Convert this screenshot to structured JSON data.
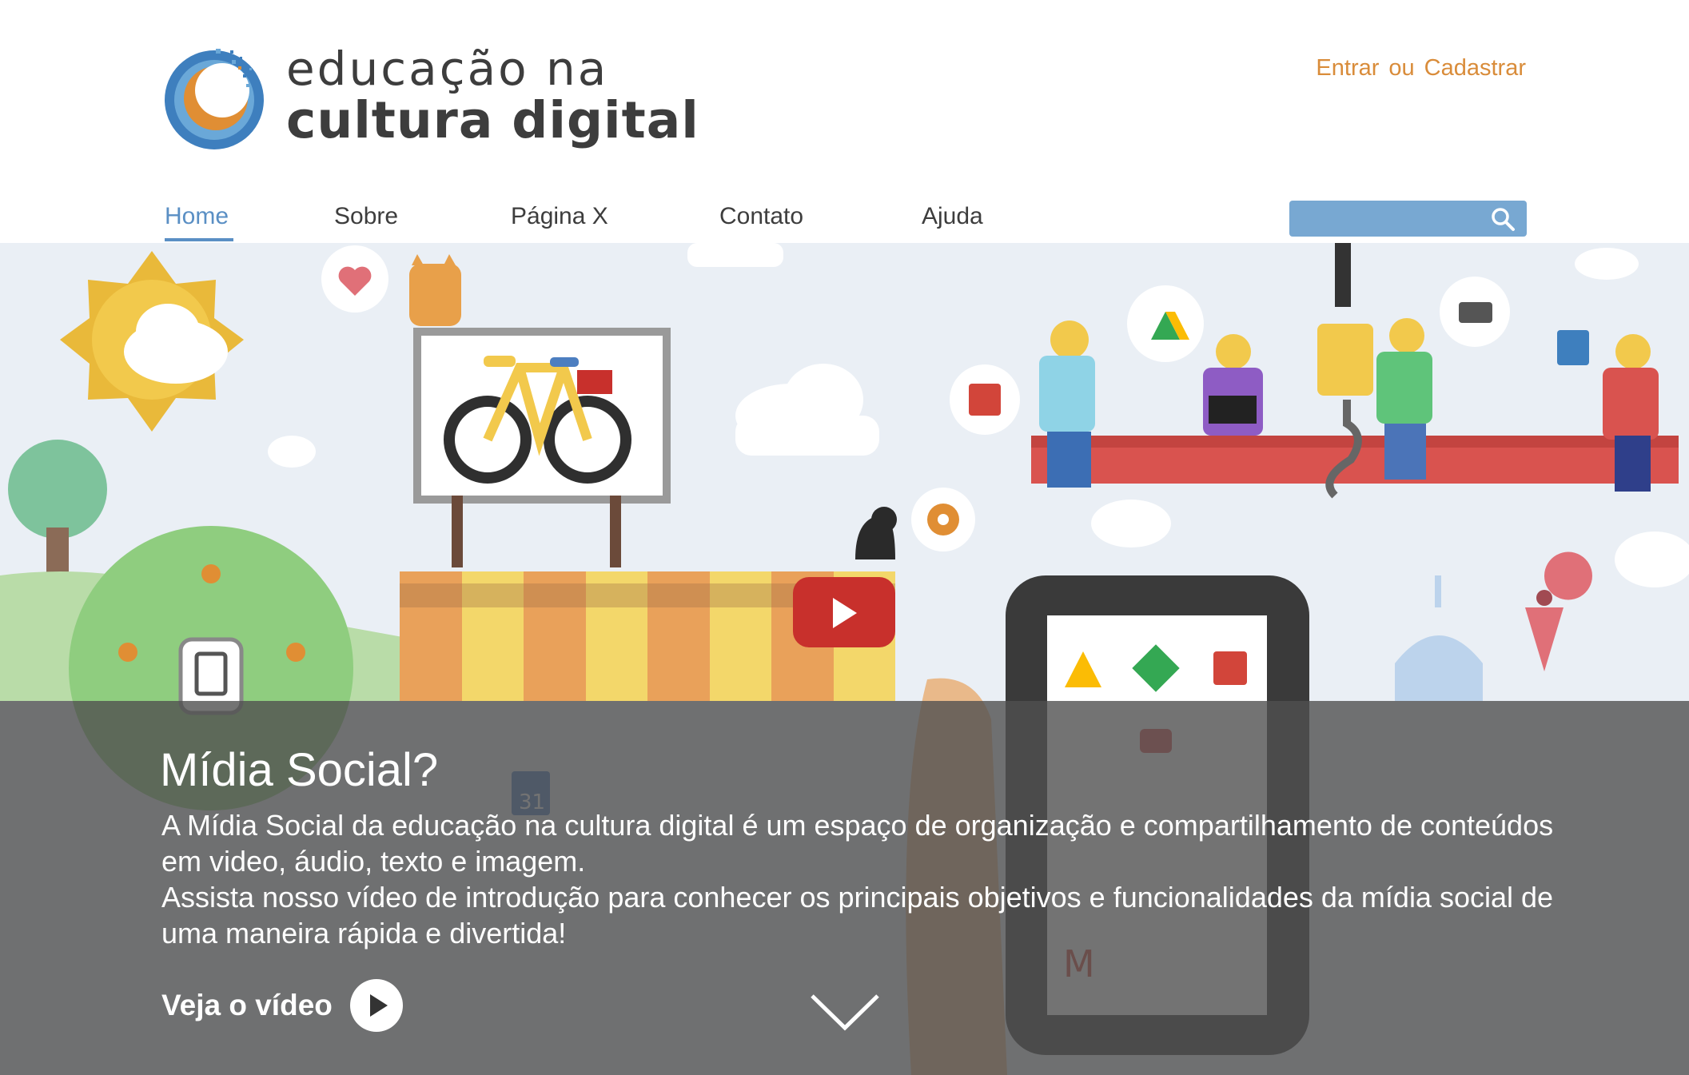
{
  "brand": {
    "line1": "educação na",
    "line2": "cultura digital"
  },
  "auth": {
    "login": "Entrar",
    "separator": "ou",
    "register": "Cadastrar"
  },
  "nav": [
    {
      "label": "Home",
      "active": true
    },
    {
      "label": "Sobre",
      "active": false
    },
    {
      "label": "Página X",
      "active": false
    },
    {
      "label": "Contato",
      "active": false
    },
    {
      "label": "Ajuda",
      "active": false
    }
  ],
  "search": {
    "placeholder": "",
    "icon": "search-icon"
  },
  "hero": {
    "title": "Mídia Social?",
    "paragraph1": "A Mídia Social da educação na cultura digital é um espaço de organização e compartilhamento de conteúdos em video, áudio, texto e imagem.",
    "paragraph2": "Assista nosso vídeo de introdução para conhecer os principais objetivos e funcionalidades da mídia social de uma maneira rápida e divertida!",
    "cta_label": "Veja o vídeo",
    "illustration_labels": {
      "calendar_day": "31"
    }
  },
  "colors": {
    "accent_orange": "#d98c3a",
    "nav_active_blue": "#5a8fc4",
    "search_bg": "#78a8d2",
    "youtube_red": "#c8302c",
    "hero_bg": "#eaeff5"
  }
}
